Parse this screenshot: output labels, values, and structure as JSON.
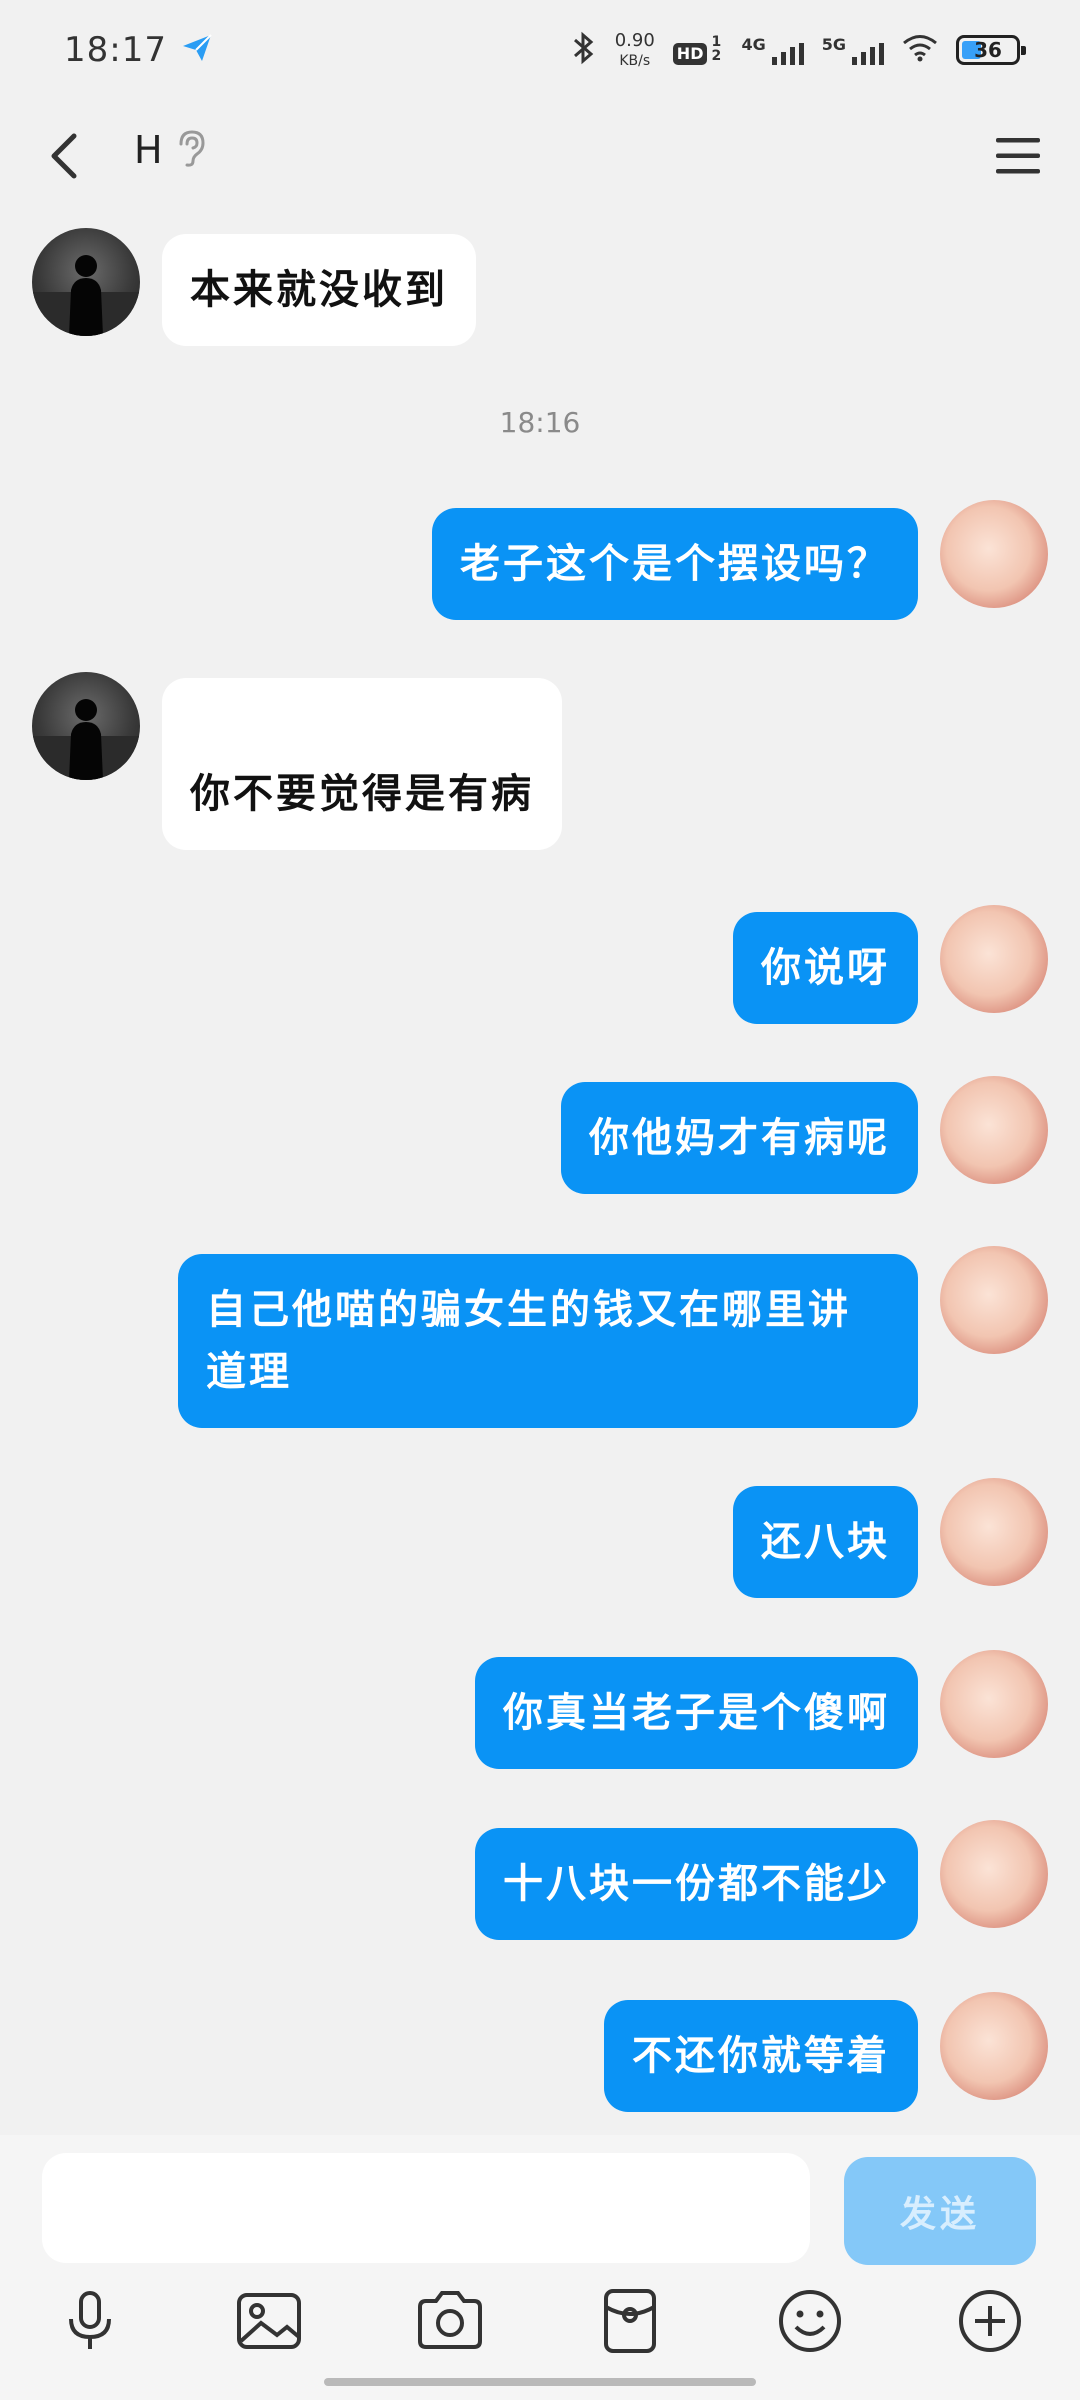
{
  "status_bar": {
    "time": "18:17",
    "net_speed_value": "0.90",
    "net_speed_unit": "KB/s",
    "hd_label": "HD",
    "hd_sub": "1 2",
    "sig1_label": "4G",
    "sig2_label": "5G",
    "battery": "36",
    "battery_level": 0.36
  },
  "header": {
    "title": "H",
    "back_icon": "back-arrow-icon",
    "ear_icon": "ear-icon",
    "menu_icon": "menu-icon"
  },
  "messages": [
    {
      "from": "other",
      "text": "本来就没收到"
    },
    {
      "type": "timestamp",
      "text": "18:16"
    },
    {
      "from": "me",
      "text": "老子这个是个摆设吗？"
    },
    {
      "from": "other",
      "text": "你不要觉得是有病"
    },
    {
      "from": "me",
      "text": "你说呀"
    },
    {
      "from": "me",
      "text": "你他妈才有病呢"
    },
    {
      "from": "me",
      "text": "自己他喵的骗女生的钱又在哪里讲道理"
    },
    {
      "from": "me",
      "text": "还八块"
    },
    {
      "from": "me",
      "text": "你真当老子是个傻啊"
    },
    {
      "from": "me",
      "text": "十八块一份都不能少"
    },
    {
      "from": "me",
      "text": "不还你就等着"
    }
  ],
  "input": {
    "placeholder": "",
    "send_label": "发送"
  },
  "toolbar": [
    "microphone-icon",
    "image-icon",
    "camera-icon",
    "red-packet-icon",
    "emoji-icon",
    "plus-icon"
  ],
  "colors": {
    "my_bubble": "#0a93f5",
    "other_bubble": "#ffffff",
    "background": "#f1f1f1",
    "send_disabled": "#84c8f8"
  }
}
